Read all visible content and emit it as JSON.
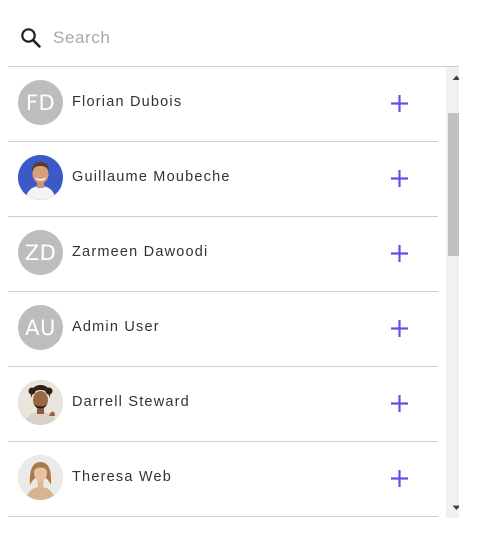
{
  "search": {
    "placeholder": "Search",
    "value": ""
  },
  "users": [
    {
      "name": "Florian Dubois",
      "initials": "FD",
      "avatar": "initials"
    },
    {
      "name": "Guillaume Moubeche",
      "initials": "",
      "avatar": "photo"
    },
    {
      "name": "Zarmeen Dawoodi",
      "initials": "ZD",
      "avatar": "initials"
    },
    {
      "name": "Admin User",
      "initials": "AU",
      "avatar": "initials"
    },
    {
      "name": "Darrell Steward",
      "initials": "",
      "avatar": "photo"
    },
    {
      "name": "Theresa Web",
      "initials": "",
      "avatar": "photo"
    }
  ],
  "icons": {
    "search": "search-icon",
    "add": "plus-icon",
    "scroll_up": "caret-up-icon",
    "scroll_down": "caret-down-icon"
  },
  "colors": {
    "accent": "#6a4de8",
    "avatar_bg": "#bdbdbd",
    "divider": "#cfcfcf",
    "scroll_track": "#f1f1f1",
    "scroll_thumb": "#c1c1c1"
  }
}
